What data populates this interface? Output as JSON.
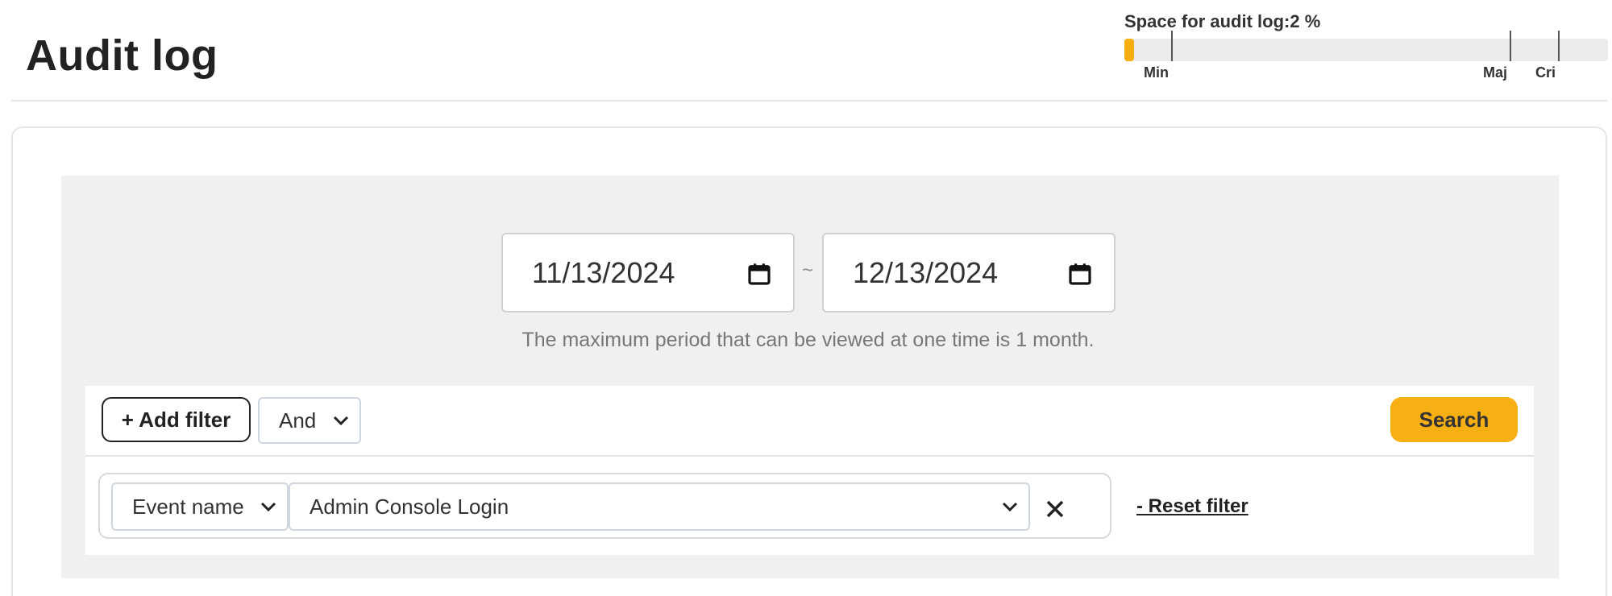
{
  "header": {
    "title": "Audit log"
  },
  "usage": {
    "label_prefix": "Space for audit log:",
    "value_text": "2 %",
    "percent": 2,
    "fill_color": "#f6ad10",
    "thresholds": [
      {
        "label": "Min"
      },
      {
        "label": "Maj"
      },
      {
        "label": "Cri"
      }
    ]
  },
  "period": {
    "start_date": "11/13/2024",
    "end_date": "12/13/2024",
    "separator": "~",
    "note": "The maximum period that can be viewed at one time is 1 month.",
    "calendar_icon": "calendar-icon"
  },
  "filters": {
    "add_filter_label": "+ Add filter",
    "logic_operator": "And",
    "search_label": "Search",
    "search_color": "#f7b013",
    "rows": [
      {
        "field": "Event name",
        "value": "Admin Console Login"
      }
    ],
    "reset_label": "- Reset filter"
  }
}
